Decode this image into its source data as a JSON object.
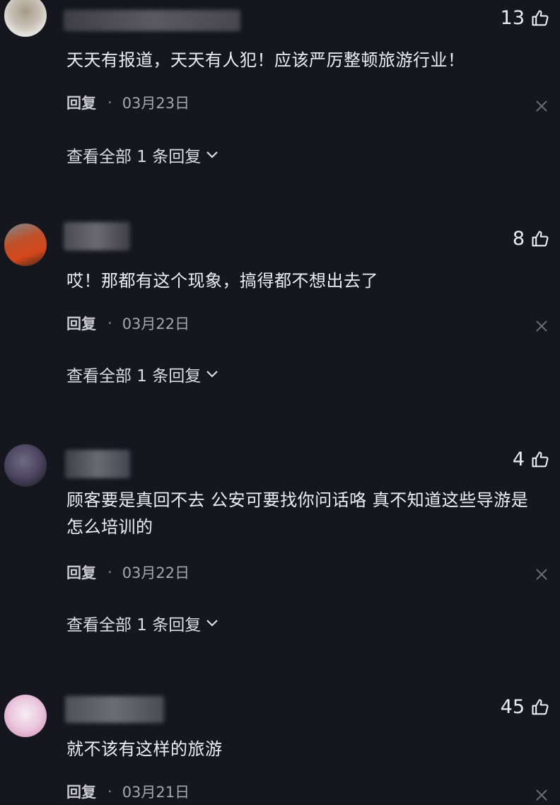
{
  "comments": [
    {
      "likes": "13",
      "text": "天天有报道，天天有人犯！应该严厉整顿旅游行业！",
      "reply_label": "回复",
      "separator": "·",
      "date": "03月23日",
      "view_all": "查看全部 1 条回复"
    },
    {
      "likes": "8",
      "text": "哎！那都有这个现象，搞得都不想出去了",
      "reply_label": "回复",
      "separator": "·",
      "date": "03月22日",
      "view_all": "查看全部 1 条回复"
    },
    {
      "likes": "4",
      "text": "顾客要是真回不去 公安可要找你问话咯 真不知道这些导游是怎么培训的",
      "reply_label": "回复",
      "separator": "·",
      "date": "03月22日",
      "view_all": "查看全部 1 条回复"
    },
    {
      "likes": "45",
      "text": "就不该有这样的旅游",
      "reply_label": "回复",
      "separator": "·",
      "date": "03月21日"
    }
  ],
  "icons": {
    "like": "thumbs-up-icon",
    "dismiss": "close-icon",
    "expand": "chevron-down-icon"
  },
  "colors": {
    "background": "#16161e",
    "text": "#ededf2",
    "muted": "#a6a6ae"
  }
}
